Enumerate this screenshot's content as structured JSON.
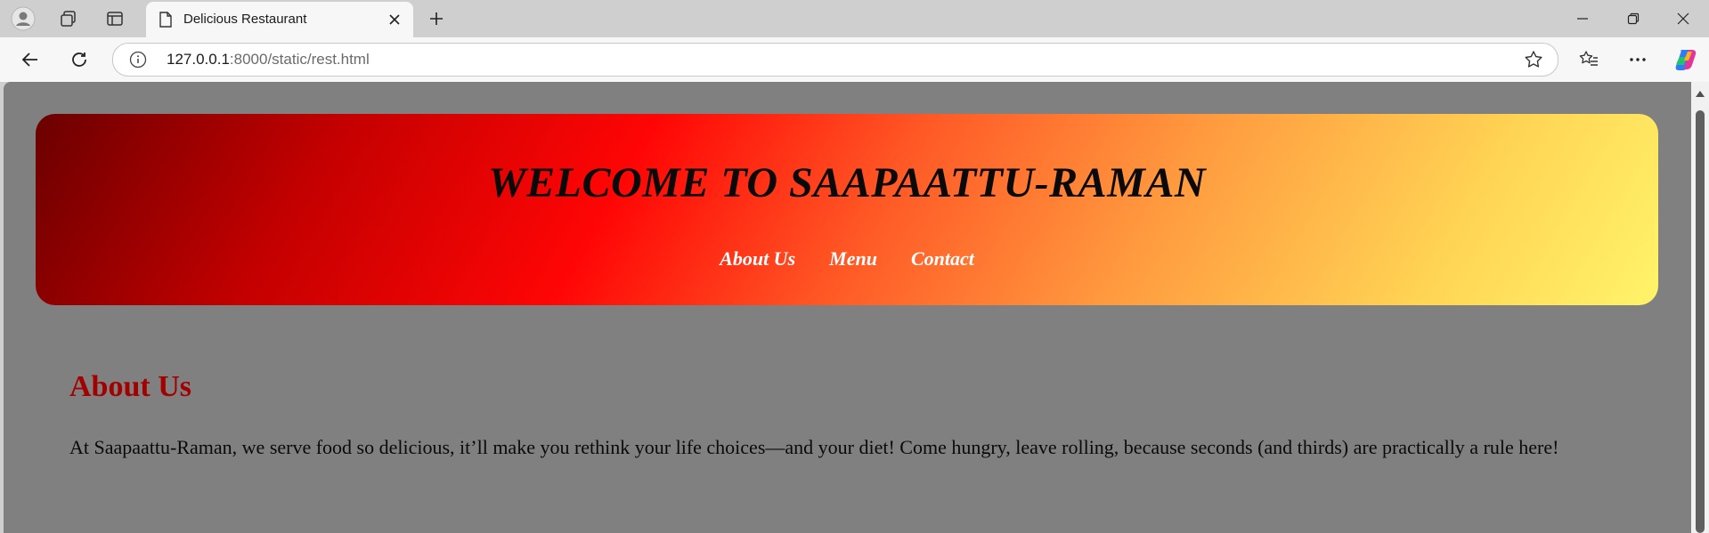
{
  "browser": {
    "tab_title": "Delicious Restaurant",
    "url_host": "127.0.0.1",
    "url_rest": ":8000/static/rest.html"
  },
  "page": {
    "hero_title": "WELCOME TO SAAPAATTU-RAMAN",
    "nav": [
      {
        "label": "About Us"
      },
      {
        "label": "Menu"
      },
      {
        "label": "Contact"
      }
    ],
    "about_heading": "About Us",
    "about_text": "At Saapaattu-Raman, we serve food so delicious, it’ll make you rethink your life choices—and your diet! Come hungry, leave rolling, because seconds (and thirds) are practically a rule here!"
  },
  "colors": {
    "page_background": "#808080",
    "heading_red": "#a30000",
    "gradient_start": "#6b0000",
    "gradient_mid": "#ff0505",
    "gradient_end": "#fff46a"
  },
  "icons": [
    "profile-icon",
    "workspaces-icon",
    "tab-actions-icon",
    "page-icon",
    "close-icon",
    "plus-icon",
    "minimize-icon",
    "restore-icon",
    "window-close-icon",
    "back-icon",
    "refresh-icon",
    "info-icon",
    "star-icon",
    "favorites-icon",
    "more-icon",
    "copilot-icon"
  ]
}
